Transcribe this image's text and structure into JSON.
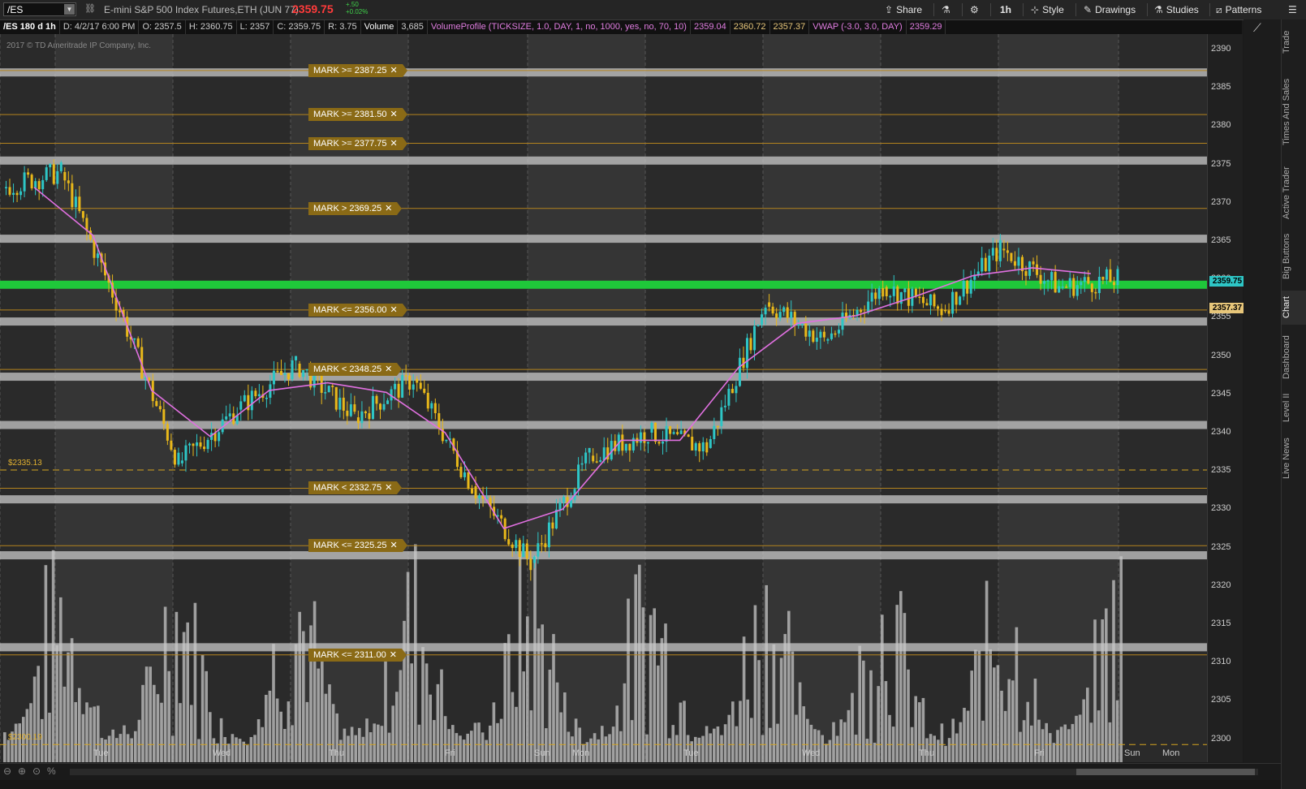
{
  "toolbar": {
    "symbol": "/ES",
    "description": "E-mini S&P 500 Index Futures,ETH (JUN 77)",
    "last_price": "2359.75",
    "net_change": "+.50",
    "pct_change": "+0.02%",
    "buttons": {
      "share": "Share",
      "timeframe": "1h",
      "style": "Style",
      "drawings": "Drawings",
      "studies": "Studies",
      "patterns": "Patterns"
    }
  },
  "info_bar": {
    "chart_id": "/ES 180 d 1h",
    "date": "D: 4/2/17 6:00 PM",
    "open": "O: 2357.5",
    "high": "H: 2360.75",
    "low": "L: 2357",
    "close": "C: 2359.75",
    "range": "R: 3.75",
    "volume_label": "Volume",
    "volume_value": "3,685",
    "vp_study": "VolumeProfile (TICKSIZE, 1.0, DAY, 1, no, 1000, yes, no, 70, 10)",
    "vp_val1": "2359.04",
    "vp_val2": "2360.72",
    "vp_val3": "2357.37",
    "vwap_study": "VWAP (-3.0, 3.0, DAY)",
    "vwap_val": "2359.29"
  },
  "copyright": "2017 © TD Ameritrade IP Company, Inc.",
  "price_axis": {
    "labels": [
      "2390",
      "2385",
      "2380",
      "2375",
      "2370",
      "2365",
      "2360",
      "2355",
      "2350",
      "2345",
      "2340",
      "2335",
      "2330",
      "2325",
      "2320",
      "2315",
      "2310",
      "2305",
      "2300"
    ],
    "last_price_tag": "2359.75",
    "vwap_tag": "2357.37",
    "last_price_color": "#2ec6c6",
    "vwap_tag_color": "#e7c67a"
  },
  "time_axis": [
    "Tue",
    "Wed",
    "Thu",
    "Fri",
    "Sun",
    "Mon",
    "Tue",
    "Wed",
    "Thu",
    "Fri",
    "Sun",
    "Mon"
  ],
  "price_bubbles": [
    "$2335.13",
    "$2300.19"
  ],
  "alerts": [
    {
      "label": "MARK >= 2387.25",
      "price": 2387.25
    },
    {
      "label": "MARK >= 2381.50",
      "price": 2381.5
    },
    {
      "label": "MARK >= 2377.75",
      "price": 2377.75
    },
    {
      "label": "MARK > 2369.25",
      "price": 2369.25
    },
    {
      "label": "MARK <= 2356.00",
      "price": 2356.0
    },
    {
      "label": "MARK < 2348.25",
      "price": 2348.25
    },
    {
      "label": "MARK < 2332.75",
      "price": 2332.75
    },
    {
      "label": "MARK <= 2325.25",
      "price": 2325.25
    },
    {
      "label": "MARK <= 2311.00",
      "price": 2311.0
    }
  ],
  "chart_data": {
    "type": "candlestick",
    "symbol": "/ES",
    "interval": "1h",
    "ylim": [
      2297,
      2392
    ],
    "support_resistance_levels": [
      2387,
      2375.5,
      2365.3,
      2354.5,
      2347.3,
      2341,
      2331.3,
      2324,
      2312
    ],
    "highlight_level": 2359.3,
    "dashed_levels": [
      2335.13,
      2299.3
    ],
    "sessions": [
      {
        "day": "Tue",
        "ohlc": [
          2372,
          2376,
          2366,
          2374
        ]
      },
      {
        "day": "Tue",
        "ohlc": [
          2374,
          2379,
          2354,
          2356
        ]
      },
      {
        "day": "Wed",
        "ohlc": [
          2356,
          2357,
          2333,
          2336
        ]
      },
      {
        "day": "Wed",
        "ohlc": [
          2336,
          2345,
          2334,
          2343
        ]
      },
      {
        "day": "Thu",
        "ohlc": [
          2343,
          2350,
          2340,
          2349
        ]
      },
      {
        "day": "Thu",
        "ohlc": [
          2349,
          2356,
          2339,
          2342
        ]
      },
      {
        "day": "Fri",
        "ohlc": [
          2342,
          2352,
          2340,
          2347
        ]
      },
      {
        "day": "Fri",
        "ohlc": [
          2347,
          2353,
          2327,
          2333
        ]
      },
      {
        "day": "Sun",
        "ohlc": [
          2333,
          2335,
          2319,
          2323
        ]
      },
      {
        "day": "Mon",
        "ohlc": [
          2323,
          2338,
          2322,
          2337
        ]
      },
      {
        "day": "Mon",
        "ohlc": [
          2337,
          2343,
          2336,
          2340
        ]
      },
      {
        "day": "Tue",
        "ohlc": [
          2340,
          2345,
          2333,
          2338
        ]
      },
      {
        "day": "Tue",
        "ohlc": [
          2338,
          2362,
          2337,
          2357
        ]
      },
      {
        "day": "Wed",
        "ohlc": [
          2357,
          2360,
          2348,
          2352
        ]
      },
      {
        "day": "Wed",
        "ohlc": [
          2352,
          2361,
          2349,
          2359
        ]
      },
      {
        "day": "Thu",
        "ohlc": [
          2359,
          2362,
          2354,
          2356
        ]
      },
      {
        "day": "Thu",
        "ohlc": [
          2356,
          2367,
          2355,
          2364
        ]
      },
      {
        "day": "Fri",
        "ohlc": [
          2364,
          2366,
          2357,
          2359
        ]
      },
      {
        "day": "Fri",
        "ohlc": [
          2359,
          2367,
          2357,
          2360
        ]
      }
    ]
  }
}
